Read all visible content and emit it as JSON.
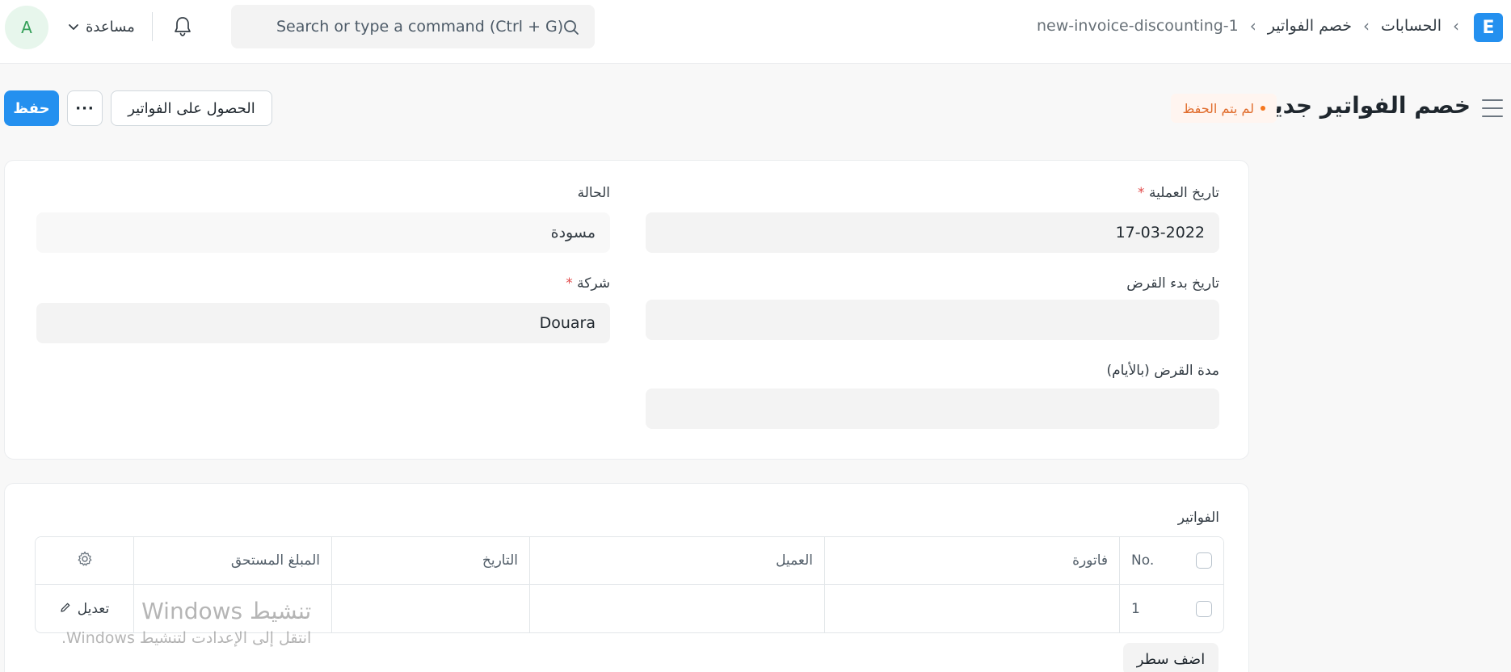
{
  "navbar": {
    "avatar_initial": "A",
    "help_label": "مساعدة",
    "search_placeholder": "Search or type a command (Ctrl + G)",
    "breadcrumbs": [
      "الحسابات",
      "خصم الفواتير",
      "new-invoice-discounting-1"
    ],
    "logo_letter": "E"
  },
  "page": {
    "title": "خصم الفواتير جديد",
    "status": "لم يتم الحفظ",
    "save_label": "حفظ",
    "more_label": "···",
    "get_invoices_label": "الحصول على الفواتير"
  },
  "form": {
    "posting_date_label": "تاريخ العملية",
    "posting_date_value": "17-03-2022",
    "status_label": "الحالة",
    "status_value": "مسودة",
    "loan_start_label": "تاريخ بدء القرض",
    "loan_start_value": "",
    "company_label": "شركة",
    "company_value": "Douara",
    "loan_period_label": "مدة القرض (بالأيام)",
    "loan_period_value": "",
    "required_mark": "*"
  },
  "invoices": {
    "section_label": "الفواتير",
    "columns": {
      "no": "No.",
      "invoice": "فاتورة",
      "customer": "العميل",
      "date": "التاريخ",
      "outstanding": "المبلغ المستحق"
    },
    "rows": [
      {
        "no": "1",
        "invoice": "",
        "customer": "",
        "date": "",
        "outstanding": "",
        "edit": "تعديل"
      }
    ],
    "add_row_label": "اضف سطر"
  },
  "watermark": {
    "line1": "تنشيط Windows",
    "line2": "انتقل إلى الإعدادت لتنشيط Windows."
  },
  "colors": {
    "primary": "#2490ef",
    "status_orange": "#e06b2a",
    "required_red": "#e24c4c",
    "avatar_green": "#36a05a"
  }
}
